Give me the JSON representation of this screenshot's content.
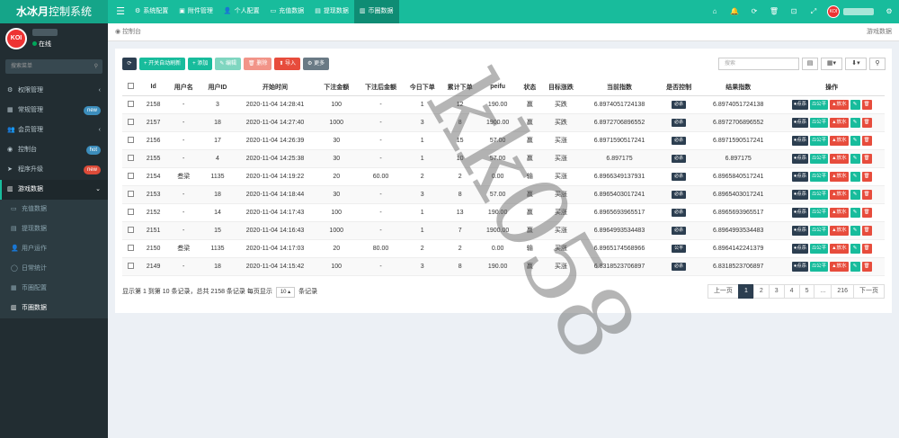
{
  "app": {
    "logo_a": "水冰月",
    "logo_b": "控制系统"
  },
  "topnav": [
    {
      "icon": "⚙",
      "label": "系统配置",
      "active": false
    },
    {
      "icon": "▣",
      "label": "附件管理",
      "active": false
    },
    {
      "icon": "👤",
      "label": "个人配置",
      "active": false
    },
    {
      "icon": "▭",
      "label": "充值数据",
      "active": false
    },
    {
      "icon": "▤",
      "label": "提现数据",
      "active": false
    },
    {
      "icon": "▥",
      "label": "币圈数据",
      "active": true
    }
  ],
  "user": {
    "status": "在线",
    "avatar_text": "KOI"
  },
  "search": {
    "placeholder": "搜索菜单"
  },
  "menu": [
    {
      "icon": "⚙",
      "label": "权限管理",
      "arrow": "‹"
    },
    {
      "icon": "▦",
      "label": "常规管理",
      "badge": "new",
      "badge_color": "#3c8dbc"
    },
    {
      "icon": "👥",
      "label": "会员管理",
      "arrow": "‹"
    },
    {
      "icon": "◉",
      "label": "控制台",
      "badge": "hot",
      "badge_color": "#3c8dbc"
    },
    {
      "icon": "➤",
      "label": "程序升级",
      "badge": "new",
      "badge_color": "#dd4b39"
    },
    {
      "icon": "▥",
      "label": "游戏数据",
      "arrow": "⌄"
    }
  ],
  "submenu": [
    {
      "icon": "▭",
      "label": "充值数据"
    },
    {
      "icon": "▤",
      "label": "提现数据"
    },
    {
      "icon": "👤",
      "label": "用户运作"
    },
    {
      "icon": "◯",
      "label": "日常统计"
    },
    {
      "icon": "▦",
      "label": "币圈配置"
    },
    {
      "icon": "▥",
      "label": "币圈数据"
    }
  ],
  "breadcrumb": {
    "left": "控制台",
    "right": "游戏数据"
  },
  "toolbar": {
    "refresh": "⟳",
    "auto_refresh": "+ 开关自动刷新",
    "add": "+ 添加",
    "edit": "✎ 编辑",
    "delete": "🗑 删除",
    "import": "⬆ 导入",
    "more": "⚙ 更多",
    "search_placeholder": "搜索"
  },
  "table": {
    "headers": [
      "",
      "Id",
      "用户名",
      "用户ID",
      "开始时间",
      "下注金额",
      "下注后金额",
      "今日下单",
      "累计下单",
      "peifu",
      "状态",
      "目标涨跌",
      "当前指数",
      "是否控制",
      "结果指数",
      "操作"
    ],
    "rows": [
      [
        "2158",
        "-",
        "3",
        "2020-11-04 14:28:41",
        "100",
        "-",
        "1",
        "12",
        "190.00",
        "赢",
        "买跌",
        "6.8974051724138",
        "必杀",
        "6.8974051724138"
      ],
      [
        "2157",
        "-",
        "18",
        "2020-11-04 14:27:40",
        "1000",
        "-",
        "3",
        "8",
        "1900.00",
        "赢",
        "买跌",
        "6.8972706896552",
        "必杀",
        "6.8972706896552"
      ],
      [
        "2156",
        "-",
        "17",
        "2020-11-04 14:26:39",
        "30",
        "-",
        "1",
        "15",
        "57.00",
        "赢",
        "买涨",
        "6.8971590517241",
        "必杀",
        "6.8971590517241"
      ],
      [
        "2155",
        "-",
        "4",
        "2020-11-04 14:25:38",
        "30",
        "-",
        "1",
        "10",
        "57.00",
        "赢",
        "买涨",
        "6.897175",
        "必杀",
        "6.897175"
      ],
      [
        "2154",
        "叁梁",
        "1135",
        "2020-11-04 14:19:22",
        "20",
        "60.00",
        "2",
        "2",
        "0.00",
        "输",
        "买涨",
        "6.8966349137931",
        "必杀",
        "6.8965840517241"
      ],
      [
        "2153",
        "-",
        "18",
        "2020-11-04 14:18:44",
        "30",
        "-",
        "3",
        "8",
        "57.00",
        "赢",
        "买涨",
        "6.8965403017241",
        "必杀",
        "6.8965403017241"
      ],
      [
        "2152",
        "-",
        "14",
        "2020-11-04 14:17:43",
        "100",
        "-",
        "1",
        "13",
        "190.00",
        "赢",
        "买涨",
        "6.8965693965517",
        "必杀",
        "6.8965693965517"
      ],
      [
        "2151",
        "-",
        "15",
        "2020-11-04 14:16:43",
        "1000",
        "-",
        "1",
        "7",
        "1900.00",
        "赢",
        "买涨",
        "6.8964993534483",
        "必杀",
        "6.8964993534483"
      ],
      [
        "2150",
        "叁梁",
        "1135",
        "2020-11-04 14:17:03",
        "20",
        "80.00",
        "2",
        "2",
        "0.00",
        "输",
        "买涨",
        "6.8965174568966",
        "公平",
        "6.8964142241379"
      ],
      [
        "2149",
        "-",
        "18",
        "2020-11-04 14:15:42",
        "100",
        "-",
        "3",
        "8",
        "190.00",
        "赢",
        "买涨",
        "6.8318523706897",
        "必杀",
        "6.8318523706897"
      ]
    ],
    "ops": {
      "kill": "●点杀",
      "fair": "⚖公平",
      "release": "▲放水"
    }
  },
  "footer": {
    "info_a": "显示第 1 到第 10 条记录，总共 2158 条记录 每页显示",
    "page_size": "10 ▴",
    "info_b": "条记录"
  },
  "pager": [
    "上一页",
    "1",
    "2",
    "3",
    "4",
    "5",
    "...",
    "216",
    "下一页"
  ],
  "watermark": "kk058"
}
